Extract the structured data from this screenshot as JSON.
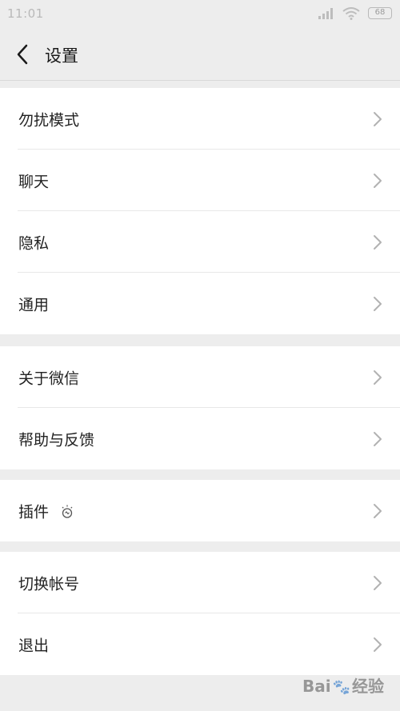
{
  "status_bar": {
    "time": "11:01",
    "battery": "68"
  },
  "nav": {
    "title": "设置",
    "back_icon": "chevron-left-icon"
  },
  "groups": [
    {
      "items": [
        {
          "label": "勿扰模式"
        },
        {
          "label": "聊天"
        },
        {
          "label": "隐私"
        },
        {
          "label": "通用"
        }
      ]
    },
    {
      "items": [
        {
          "label": "关于微信"
        },
        {
          "label": "帮助与反馈"
        }
      ]
    },
    {
      "items": [
        {
          "label": "插件",
          "icon": "lightbulb-icon"
        }
      ]
    },
    {
      "items": [
        {
          "label": "切换帐号"
        },
        {
          "label": "退出"
        }
      ]
    }
  ],
  "watermark": {
    "brand": "Bai",
    "brand_suffix": "经验"
  },
  "colors": {
    "background": "#ededed",
    "card": "#ffffff",
    "text": "#222222",
    "chevron": "#b2b2b2"
  }
}
